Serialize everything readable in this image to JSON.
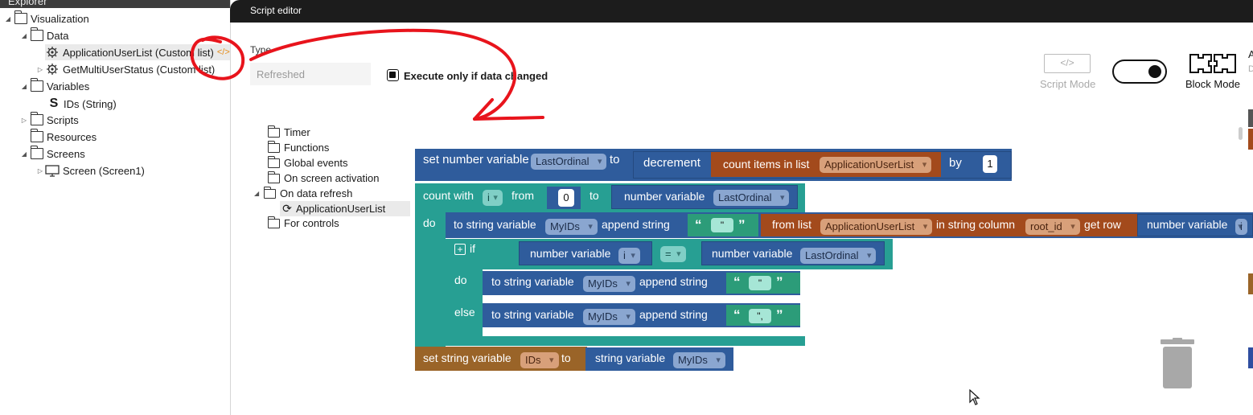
{
  "explorer": {
    "title": "Explorer",
    "tree": [
      {
        "label": "Visualization",
        "icon": "folder-icon"
      },
      {
        "label": "Data",
        "icon": "folder-icon"
      },
      {
        "label": "ApplicationUserList (Custom list)",
        "icon": "gear-icon",
        "badge": "</>"
      },
      {
        "label": "GetMultiUserStatus (Custom list)",
        "icon": "gear-icon"
      },
      {
        "label": "Variables",
        "icon": "folder-icon"
      },
      {
        "label": "IDs (String)",
        "icon": "string-icon"
      },
      {
        "label": "Scripts",
        "icon": "folder-icon"
      },
      {
        "label": "Resources",
        "icon": "folder-icon"
      },
      {
        "label": "Screens",
        "icon": "folder-icon"
      },
      {
        "label": "Screen (Screen1)",
        "icon": "monitor-icon"
      }
    ]
  },
  "editor": {
    "title": "Script editor",
    "type_label": "Type",
    "type_value": "Refreshed",
    "execute_label": "Execute only if data changed",
    "execute_checked": true,
    "script_mode_label": "Script Mode",
    "block_mode_label": "Block Mode",
    "mode_toggle_on": true,
    "cut_text_a": "A",
    "cut_text_d": "D"
  },
  "categories": [
    {
      "label": "Timer"
    },
    {
      "label": "Functions"
    },
    {
      "label": "Global events"
    },
    {
      "label": "On screen activation"
    },
    {
      "label": "On data refresh"
    },
    {
      "label": "ApplicationUserList"
    },
    {
      "label": "For controls"
    }
  ],
  "blocks": {
    "set_number": {
      "prefix": "set number variable",
      "var": "LastOrdinal",
      "to": "to"
    },
    "decrement": {
      "label": "decrement",
      "by": "by",
      "amount": "1"
    },
    "count_items": {
      "label": "count items in list",
      "list": "ApplicationUserList"
    },
    "count_with": {
      "label": "count with",
      "var": "i",
      "from": "from",
      "from_value": "0",
      "to": "to",
      "do": "do"
    },
    "number_var_last": {
      "label": "number variable",
      "var": "LastOrdinal"
    },
    "append1": {
      "label": "to string variable",
      "var": "MyIDs",
      "action": "append string",
      "str": "\""
    },
    "from_list": {
      "label": "from list",
      "list": "ApplicationUserList",
      "in_col": "in string column",
      "col": "root_id",
      "get_row": "get row"
    },
    "number_var_i_cut": {
      "label": "number variable",
      "var": "i"
    },
    "if": {
      "label": "if",
      "do": "do",
      "else": "else"
    },
    "cmp_left": {
      "label": "number variable",
      "var": "i"
    },
    "cmp_op": "=",
    "cmp_right": {
      "label": "number variable",
      "var": "LastOrdinal"
    },
    "append2": {
      "label": "to string variable",
      "var": "MyIDs",
      "action": "append string",
      "str": "\""
    },
    "append3": {
      "label": "to string variable",
      "var": "MyIDs",
      "action": "append string",
      "str": "\","
    },
    "set_string": {
      "label": "set string variable",
      "var": "IDs",
      "to": "to"
    },
    "string_var": {
      "label": "string variable",
      "var": "MyIDs"
    },
    "quote_open": "“",
    "quote_close": "”"
  },
  "colors": {
    "number_block": "#2f5c9c",
    "list_block": "#a34a1c",
    "loop_block": "#279f93",
    "string_block": "#2c9c79",
    "string_var_block": "#9a6428",
    "annotation": "#e8141c"
  }
}
